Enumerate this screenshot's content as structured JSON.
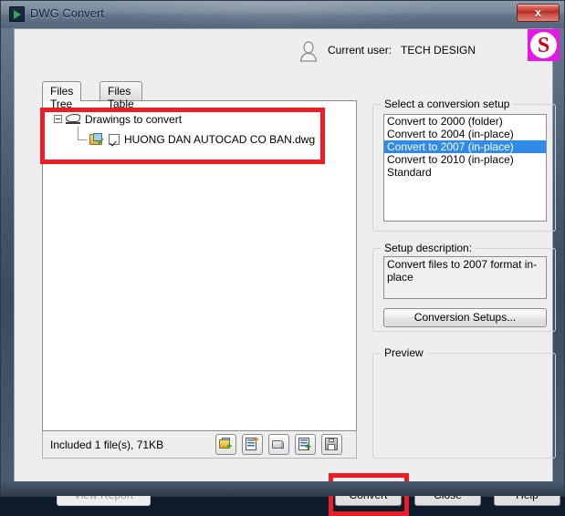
{
  "window": {
    "title": "DWG Convert",
    "app_icon": "dwg-convert-icon",
    "close_label": "x"
  },
  "header": {
    "user_icon": "user-silhouette-icon",
    "user_label": "Current user:",
    "user_name": "TECH DESIGN",
    "brand_logo_letter": "S"
  },
  "left": {
    "tabs": [
      {
        "label": "Files Tree",
        "active": true
      },
      {
        "label": "Files Table",
        "active": false
      }
    ],
    "tree": {
      "root_label": "Drawings to convert",
      "child_label": "HUONG DAN AUTOCAD CO BAN.dwg",
      "child_checked": true,
      "root_icon": "drawings-stack-icon",
      "child_icon": "drawing-file-icon"
    },
    "status_text": "Included 1 file(s), 71KB",
    "toolbar": [
      {
        "name": "add-drawings-icon"
      },
      {
        "name": "new-list-icon"
      },
      {
        "name": "open-list-icon"
      },
      {
        "name": "append-list-icon"
      },
      {
        "name": "save-list-icon"
      }
    ]
  },
  "right": {
    "setup_group_title": "Select a conversion setup",
    "setups": [
      {
        "label": "Convert to 2000 (folder)",
        "selected": false
      },
      {
        "label": "Convert to 2004 (in-place)",
        "selected": false
      },
      {
        "label": "Convert to 2007 (in-place)",
        "selected": true
      },
      {
        "label": "Convert to 2010 (in-place)",
        "selected": false
      },
      {
        "label": "Standard",
        "selected": false
      }
    ],
    "description_group_title": "Setup description:",
    "description_text": "Convert files to 2007 format in-place",
    "conversion_setups_button": "Conversion Setups...",
    "preview_group_title": "Preview"
  },
  "footer": {
    "view_report": "View Report",
    "convert": "Convert",
    "close": "Close",
    "help": "Help"
  },
  "colors": {
    "selection_blue": "#2f8ae8",
    "highlight_red": "#ee1c25",
    "brand_magenta": "#e617e6",
    "brand_red": "#d0021b"
  }
}
